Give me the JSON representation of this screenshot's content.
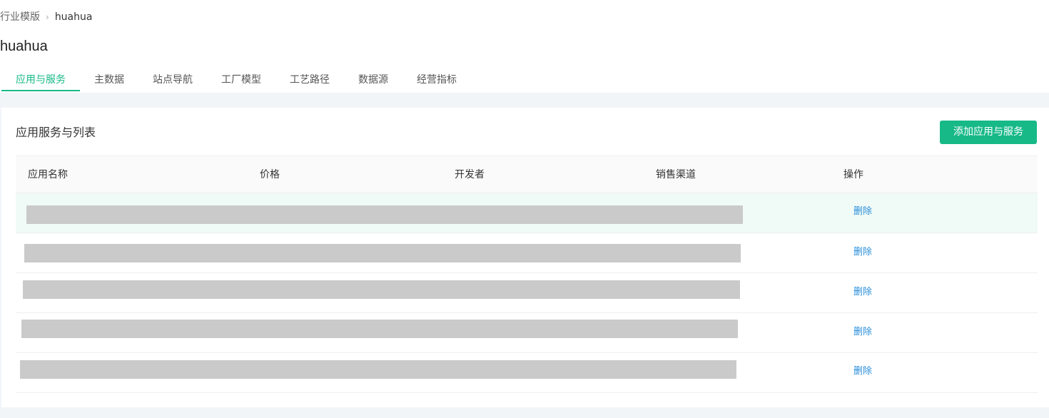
{
  "breadcrumb": {
    "parent": "行业模版",
    "separator": "›",
    "current": "huahua"
  },
  "page_title": "huahua",
  "tabs": [
    {
      "label": "应用与服务",
      "active": true
    },
    {
      "label": "主数据",
      "active": false
    },
    {
      "label": "站点导航",
      "active": false
    },
    {
      "label": "工厂模型",
      "active": false
    },
    {
      "label": "工艺路径",
      "active": false
    },
    {
      "label": "数据源",
      "active": false
    },
    {
      "label": "经营指标",
      "active": false
    }
  ],
  "card": {
    "title": "应用服务与列表",
    "add_button_label": "添加应用与服务"
  },
  "table": {
    "columns": [
      "应用名称",
      "价格",
      "开发者",
      "销售渠道",
      "操作"
    ],
    "rows": [
      {
        "action": "删除",
        "content_redacted": true
      },
      {
        "action": "删除",
        "content_redacted": true
      },
      {
        "action": "删除",
        "content_redacted": true
      },
      {
        "action": "删除",
        "content_redacted": true
      },
      {
        "action": "删除",
        "content_redacted": true
      }
    ]
  },
  "colors": {
    "accent": "#17b987",
    "link": "#2a8fdb",
    "page_background": "#f2f5f8",
    "redaction": "#cacaca",
    "row_hover": "#f0faf7"
  }
}
